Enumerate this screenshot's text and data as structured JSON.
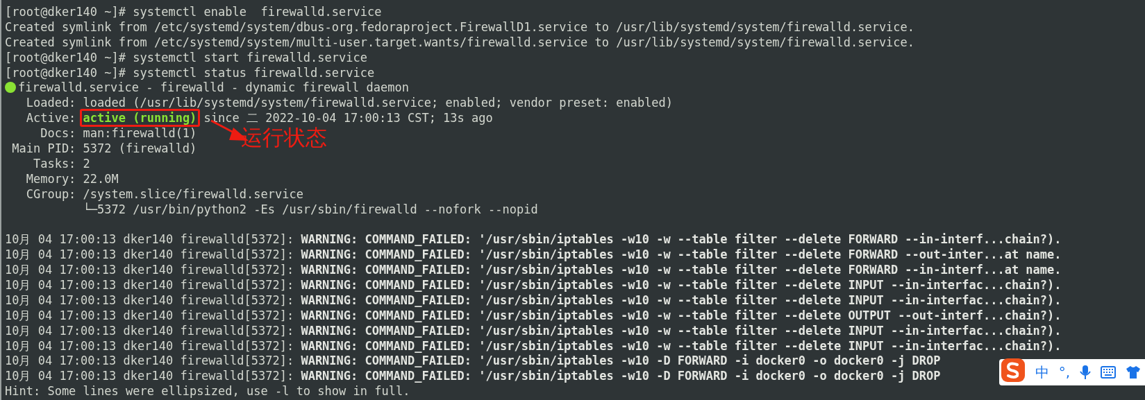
{
  "terminal": {
    "lines": [
      {
        "kind": "prompt",
        "text": "[root@dker140 ~]# systemctl enable  firewalld.service"
      },
      {
        "kind": "plain",
        "text": "Created symlink from /etc/systemd/system/dbus-org.fedoraproject.FirewallD1.service to /usr/lib/systemd/system/firewalld.service."
      },
      {
        "kind": "plain",
        "text": "Created symlink from /etc/systemd/system/multi-user.target.wants/firewalld.service to /usr/lib/systemd/system/firewalld.service."
      },
      {
        "kind": "prompt",
        "text": "[root@dker140 ~]# systemctl start firewalld.service"
      },
      {
        "kind": "prompt",
        "text": "[root@dker140 ~]# systemctl status firewalld.service"
      },
      {
        "kind": "status",
        "text": "firewalld.service - firewalld - dynamic firewall daemon",
        "color": "#8ae234"
      },
      {
        "kind": "plain",
        "text": "   Loaded: loaded (/usr/lib/systemd/system/firewalld.service; enabled; vendor preset: enabled)"
      },
      {
        "kind": "active",
        "label": "   Active: ",
        "state": "active (running)",
        "rest": " since 二 2022-10-04 17:00:13 CST; 13s ago"
      },
      {
        "kind": "plain",
        "text": "     Docs: man:firewalld(1)"
      },
      {
        "kind": "plain",
        "text": " Main PID: 5372 (firewalld)"
      },
      {
        "kind": "plain",
        "text": "    Tasks: 2"
      },
      {
        "kind": "plain",
        "text": "   Memory: 22.0M"
      },
      {
        "kind": "plain",
        "text": "   CGroup: /system.slice/firewalld.service"
      },
      {
        "kind": "plain",
        "text": "           └─5372 /usr/bin/python2 -Es /usr/sbin/firewalld --nofork --nopid"
      },
      {
        "kind": "blank"
      },
      {
        "kind": "log",
        "prefix": "10月 04 17:00:13 dker140 firewalld[5372]: ",
        "message": "WARNING: COMMAND_FAILED: '/usr/sbin/iptables -w10 -w --table filter --delete FORWARD --in-interf...chain?)."
      },
      {
        "kind": "log",
        "prefix": "10月 04 17:00:13 dker140 firewalld[5372]: ",
        "message": "WARNING: COMMAND_FAILED: '/usr/sbin/iptables -w10 -w --table filter --delete FORWARD --out-inter...at name."
      },
      {
        "kind": "log",
        "prefix": "10月 04 17:00:13 dker140 firewalld[5372]: ",
        "message": "WARNING: COMMAND_FAILED: '/usr/sbin/iptables -w10 -w --table filter --delete FORWARD --in-interf...at name."
      },
      {
        "kind": "log",
        "prefix": "10月 04 17:00:13 dker140 firewalld[5372]: ",
        "message": "WARNING: COMMAND_FAILED: '/usr/sbin/iptables -w10 -w --table filter --delete INPUT --in-interfac...chain?)."
      },
      {
        "kind": "log",
        "prefix": "10月 04 17:00:13 dker140 firewalld[5372]: ",
        "message": "WARNING: COMMAND_FAILED: '/usr/sbin/iptables -w10 -w --table filter --delete INPUT --in-interfac...chain?)."
      },
      {
        "kind": "log",
        "prefix": "10月 04 17:00:13 dker140 firewalld[5372]: ",
        "message": "WARNING: COMMAND_FAILED: '/usr/sbin/iptables -w10 -w --table filter --delete OUTPUT --out-interf...chain?)."
      },
      {
        "kind": "log",
        "prefix": "10月 04 17:00:13 dker140 firewalld[5372]: ",
        "message": "WARNING: COMMAND_FAILED: '/usr/sbin/iptables -w10 -w --table filter --delete INPUT --in-interfac...chain?)."
      },
      {
        "kind": "log",
        "prefix": "10月 04 17:00:13 dker140 firewalld[5372]: ",
        "message": "WARNING: COMMAND_FAILED: '/usr/sbin/iptables -w10 -w --table filter --delete INPUT --in-interfac...chain?)."
      },
      {
        "kind": "log",
        "prefix": "10月 04 17:00:13 dker140 firewalld[5372]: ",
        "message": "WARNING: COMMAND_FAILED: '/usr/sbin/iptables -w10 -D FORWARD -i docker0 -o docker0 -j DROP"
      },
      {
        "kind": "log",
        "prefix": "10月 04 17:00:13 dker140 firewalld[5372]: ",
        "message": "WARNING: COMMAND_FAILED: '/usr/sbin/iptables -w10 -D FORWARD -i docker0 -o docker0 -j DROP"
      },
      {
        "kind": "plain",
        "text": "Hint: Some lines were ellipsized, use -l to show in full."
      }
    ]
  },
  "annotation": {
    "label": "运行状态"
  },
  "ime_toolbar": {
    "mode": "中",
    "punctuation": "°,"
  }
}
